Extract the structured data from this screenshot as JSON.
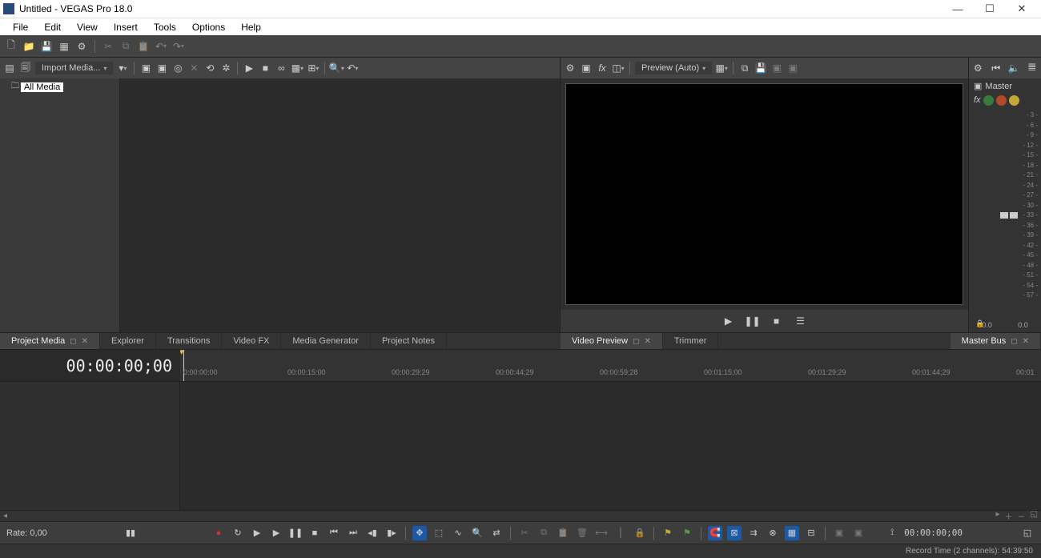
{
  "title": "Untitled - VEGAS Pro 18.0",
  "menu": [
    "File",
    "Edit",
    "View",
    "Insert",
    "Tools",
    "Options",
    "Help"
  ],
  "import_label": "Import Media...",
  "all_media": "All Media",
  "preview_label": "Preview (Auto)",
  "master_label": "Master",
  "meter_ticks": [
    "- 3 -",
    "- 6 -",
    "- 9 -",
    "- 12 -",
    "- 15 -",
    "- 18 -",
    "- 21 -",
    "- 24 -",
    "- 27 -",
    "- 30 -",
    "- 33 -",
    "- 36 -",
    "- 39 -",
    "- 42 -",
    "- 45 -",
    "- 48 -",
    "- 51 -",
    "- 54 -",
    "- 57 -"
  ],
  "meter_vals": {
    "l": "0.0",
    "r": "0.0"
  },
  "tabs_left": [
    {
      "label": "Project Media",
      "active": true,
      "closable": true
    },
    {
      "label": "Explorer"
    },
    {
      "label": "Transitions"
    },
    {
      "label": "Video FX"
    },
    {
      "label": "Media Generator"
    },
    {
      "label": "Project Notes"
    }
  ],
  "tabs_right": [
    {
      "label": "Video Preview",
      "active": true,
      "closable": true
    },
    {
      "label": "Trimmer"
    }
  ],
  "tabs_master": [
    {
      "label": "Master Bus",
      "active": true,
      "closable": true
    }
  ],
  "timecode": "00:00:00;00",
  "ruler": [
    "0:00:00:00",
    "00:00:15:00",
    "00:00:29;29",
    "00:00:44;29",
    "00:00:59;28",
    "00:01:15;00",
    "00:01:29;29",
    "00:01:44;29",
    "00:01"
  ],
  "rate": "Rate: 0,00",
  "bottom_tc": "00:00:00;00",
  "status": "Record Time (2 channels): 54:39:50"
}
